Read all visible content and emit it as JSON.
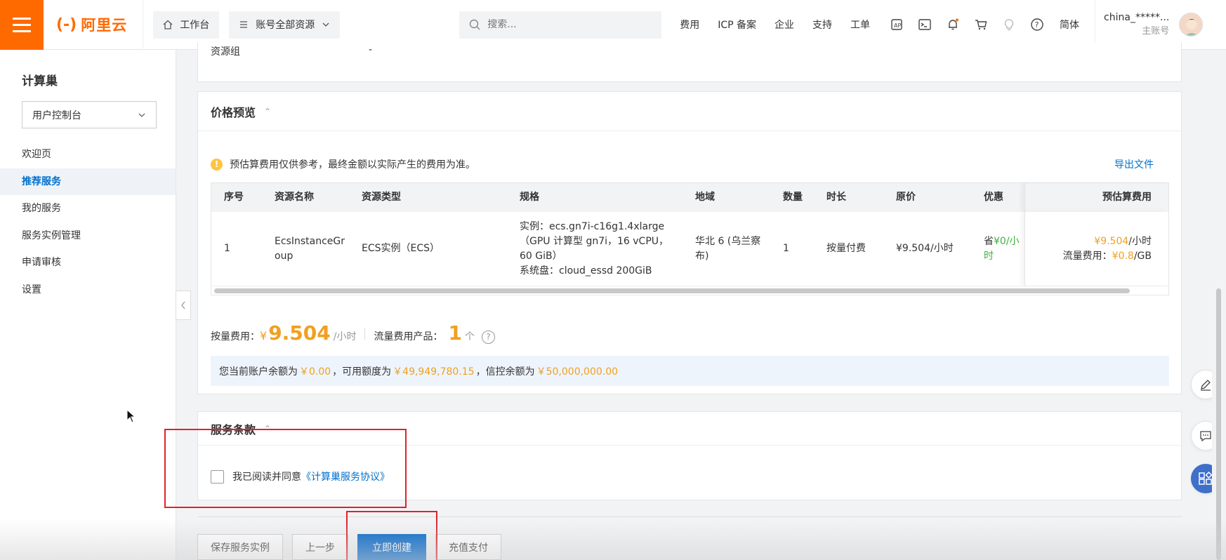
{
  "topbar": {
    "logo_text": "阿里云",
    "workbench": "工作台",
    "resources": "账号全部资源",
    "search_placeholder": "搜索...",
    "links": [
      "费用",
      "ICP 备案",
      "企业",
      "支持",
      "工单"
    ],
    "lang": "简体",
    "user_name": "china_*****...",
    "user_role": "主账号",
    "brand_color": "#ff6a00"
  },
  "sidebar": {
    "title": "计算巢",
    "select_value": "用户控制台",
    "items": [
      "欢迎页",
      "推荐服务",
      "我的服务",
      "服务实例管理",
      "申请审核",
      "设置"
    ]
  },
  "top_partial": {
    "label": "资源组",
    "value": "-"
  },
  "price_preview": {
    "title": "价格预览",
    "notice": "预估算费用仅供参考，最终金额以实际产生的费用为准。",
    "export": "导出文件",
    "columns": [
      "序号",
      "资源名称",
      "资源类型",
      "规格",
      "地域",
      "数量",
      "时长",
      "原价",
      "优惠",
      "预估算费用"
    ],
    "row": {
      "index": "1",
      "name_line1": "EcsInstanceGr",
      "name_line2": "oup",
      "type": "ECS实例（ECS）",
      "spec_line1": "实例：ecs.gn7i-c16g1.4xlarge",
      "spec_line2": "（GPU 计算型 gn7i，16 vCPU，",
      "spec_line3": "60 GiB）",
      "spec_line4": "系统盘：cloud_essd 200GiB",
      "region_line1": "华北 6 (乌兰察",
      "region_line2": "布)",
      "quantity": "1",
      "duration": "按量付费",
      "original_price": "¥9.504/小时",
      "discount_prefix": "省",
      "discount_value": "¥0/小时",
      "est_price": "¥9.504",
      "est_unit": "/小时",
      "traffic_label": "流量费用：",
      "traffic_price": "¥0.8",
      "traffic_unit": "/GB"
    },
    "pay_label": "按量费用：",
    "pay_currency": "¥",
    "pay_amount": "9.504",
    "pay_unit": "/小时",
    "traffic_products_label": "流量费用产品：",
    "traffic_products_count": "1",
    "traffic_products_unit": "个",
    "balance": {
      "t1": "您当前账户余额为",
      "v1": "￥0.00",
      "t2": "，可用额度为",
      "v2": "￥49,949,780.15",
      "t3": "，信控余额为",
      "v3": "￥50,000,000.00"
    }
  },
  "terms": {
    "title": "服务条款",
    "agree_text": "我已阅读并同意",
    "agree_link": "《计算巢服务协议》"
  },
  "actions": {
    "save": "保存服务实例",
    "prev": "上一步",
    "create": "立即创建",
    "recharge": "充值支付"
  }
}
